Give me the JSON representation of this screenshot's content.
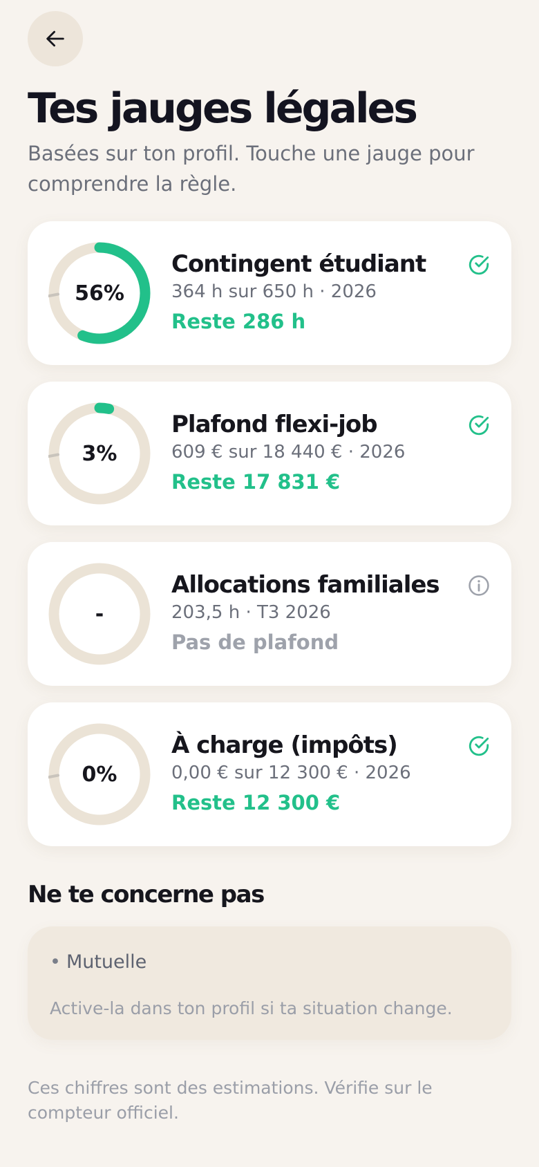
{
  "header": {
    "back_icon": "arrow-left-icon",
    "title": "Tes jauges légales",
    "subtitle": "Basées sur ton profil. Touche une jauge pour comprendre la règle."
  },
  "colors": {
    "accent": "#22c08a",
    "track": "#ebe3d6",
    "muted": "#9ea2ab",
    "background": "#f7f3ee"
  },
  "gauges": [
    {
      "title": "Contingent étudiant",
      "percent_label": "56%",
      "fraction": 0.56,
      "detail": "364 h sur 650 h · 2026",
      "remaining": "Reste 286 h",
      "status_icon": "check-circle-icon"
    },
    {
      "title": "Plafond flexi-job",
      "percent_label": "3%",
      "fraction": 0.033,
      "detail": "609 € sur 18 440 € · 2026",
      "remaining": "Reste 17 831 €",
      "status_icon": "check-circle-icon"
    },
    {
      "title": "Allocations familiales",
      "percent_label": "-",
      "fraction": 0,
      "detail": "203,5 h · T3 2026",
      "remaining": "Pas de plafond",
      "status_icon": "info-circle-icon"
    },
    {
      "title": "À charge (impôts)",
      "percent_label": "0%",
      "fraction": 0,
      "detail": "0,00 € sur 12 300 € · 2026",
      "remaining": "Reste 12 300 €",
      "status_icon": "check-circle-icon"
    }
  ],
  "not_applicable": {
    "title": "Ne te concerne pas",
    "items": [
      "Mutuelle"
    ],
    "hint": "Active-la dans ton profil si ta situation change."
  },
  "disclaimer": "Ces chiffres sont des estimations. Vérifie sur le compteur officiel."
}
